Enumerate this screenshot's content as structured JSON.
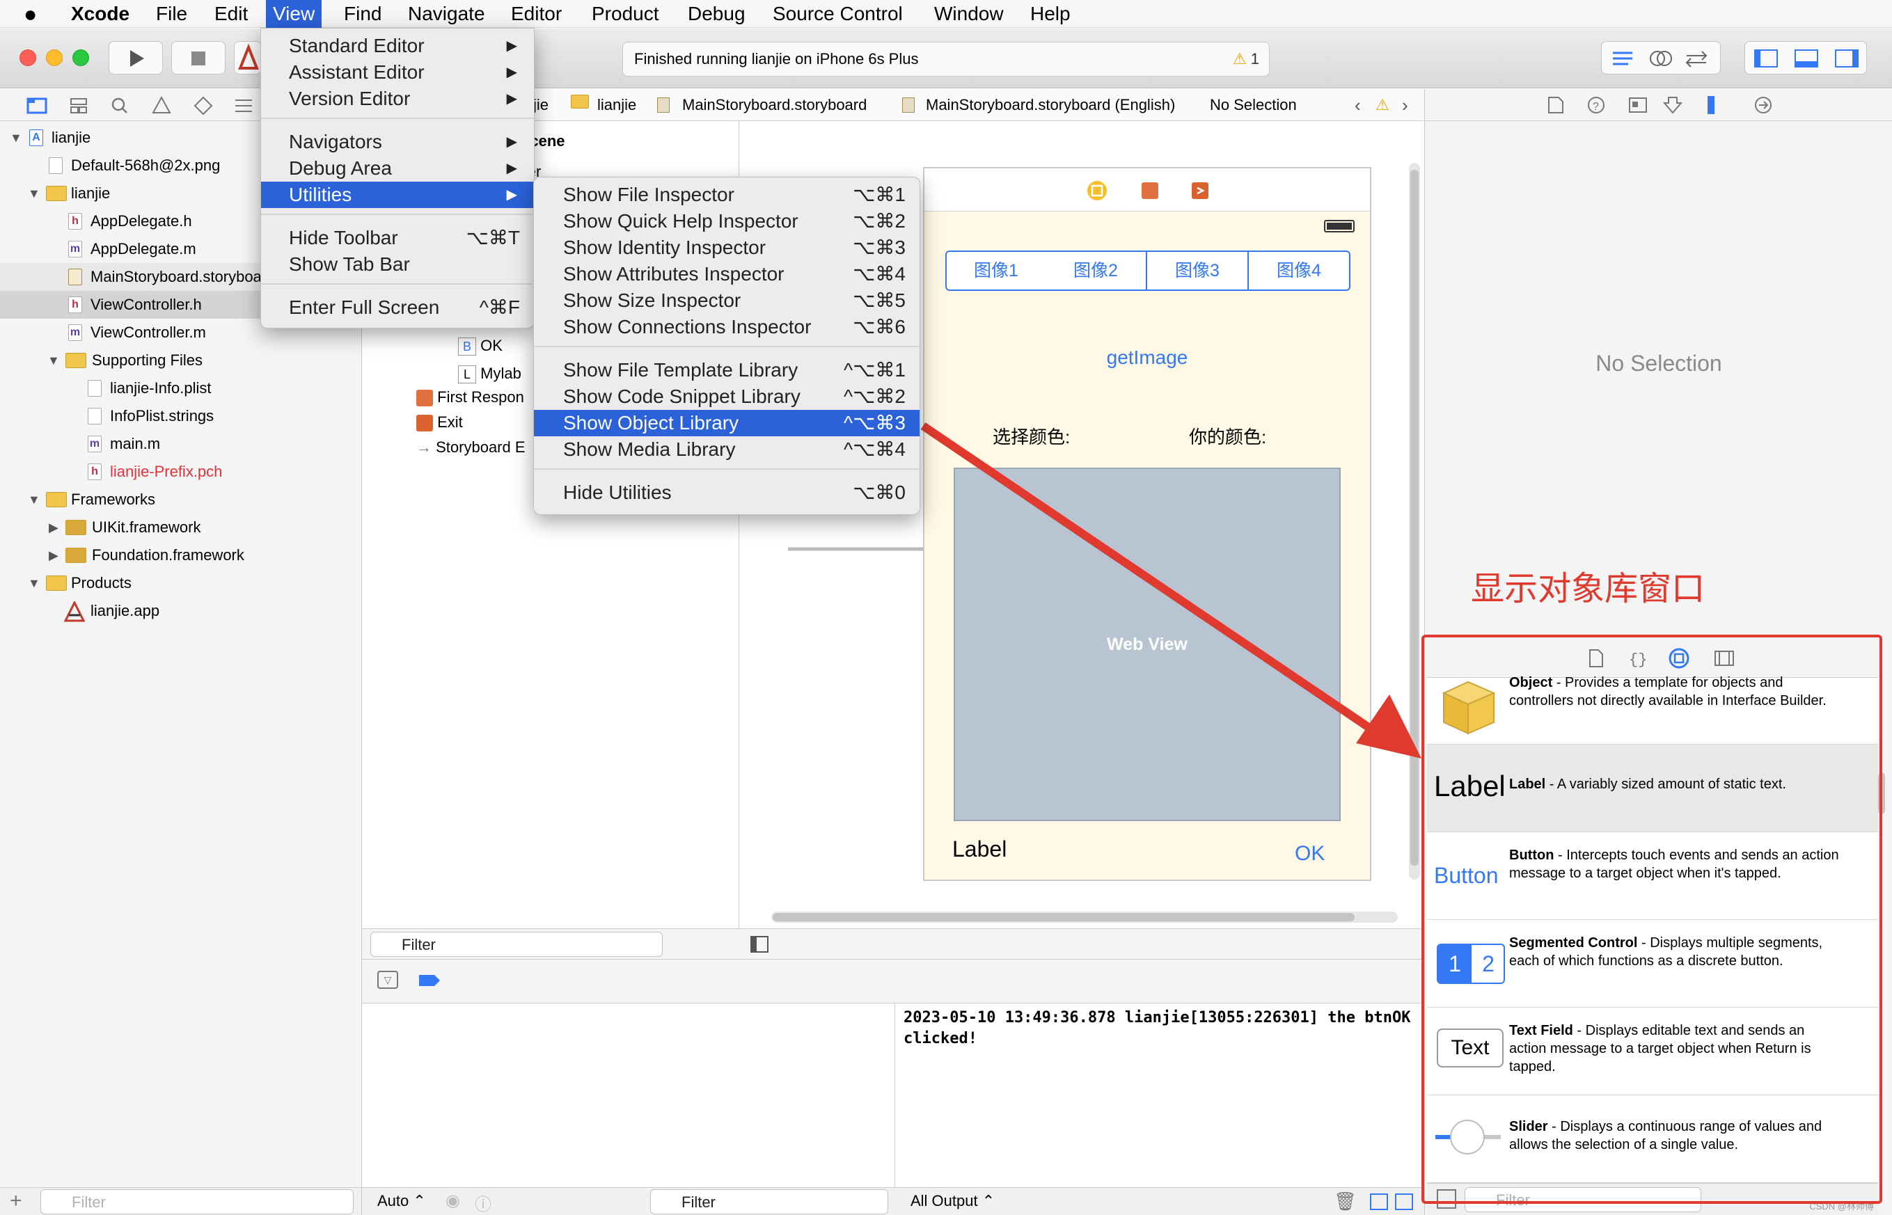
{
  "menubar": {
    "apple_icon": "apple-logo",
    "app_name": "Xcode",
    "items": [
      "File",
      "Edit",
      "View",
      "Find",
      "Navigate",
      "Editor",
      "Product",
      "Debug",
      "Source Control",
      "Window",
      "Help"
    ]
  },
  "toolbar": {
    "status_text": "Finished running lianjie on iPhone 6s Plus",
    "warning_count": "1"
  },
  "jumpbar": {
    "crumbs": [
      "jie",
      "lianjie",
      "MainStoryboard.storyboard",
      "MainStoryboard.storyboard (English)",
      "No Selection"
    ]
  },
  "navigator": {
    "items": [
      {
        "label": "lianjie"
      },
      {
        "label": "Default-568h@2x.png"
      },
      {
        "label": "lianjie"
      },
      {
        "label": "AppDelegate.h"
      },
      {
        "label": "AppDelegate.m"
      },
      {
        "label": "MainStoryboard.storyboard"
      },
      {
        "label": "ViewController.h"
      },
      {
        "label": "ViewController.m"
      },
      {
        "label": "Supporting Files"
      },
      {
        "label": "lianjie-Info.plist"
      },
      {
        "label": "InfoPlist.strings"
      },
      {
        "label": "main.m"
      },
      {
        "label": "lianjie-Prefix.pch"
      },
      {
        "label": "Frameworks"
      },
      {
        "label": "UIKit.framework"
      },
      {
        "label": "Foundation.framework"
      },
      {
        "label": "Products"
      },
      {
        "label": "lianjie.app"
      }
    ],
    "filter_placeholder": "Filter"
  },
  "outline": {
    "scene_title": "r Scene",
    "controller_partial": "ller",
    "ok": "OK",
    "mylab": "Mylab",
    "first_responder": "First Respon",
    "exit": "Exit",
    "storyboard_entry": "Storyboard E",
    "filter_placeholder": "Filter"
  },
  "canvas": {
    "segments": [
      "图像1",
      "图像2",
      "图像3",
      "图像4"
    ],
    "get_image": "getImage",
    "choose_color": "选择颜色:",
    "your_color": "你的颜色:",
    "web_view": "Web View",
    "label": "Label",
    "ok": "OK"
  },
  "debug": {
    "console_text": "2023-05-10 13:49:36.878 lianjie[13055:226301] the btnOK clicked!",
    "auto_label": "Auto",
    "filter_label": "Filter",
    "output_label": "All Output"
  },
  "inspector": {
    "no_selection": "No Selection"
  },
  "annotation": "显示对象库窗口",
  "library": {
    "items": [
      {
        "title": "Object",
        "desc": "Provides a template for objects and controllers not directly available in Interface Builder."
      },
      {
        "title": "Label",
        "desc": "A variably sized amount of static text.",
        "preview": "Label"
      },
      {
        "title": "Button",
        "desc": "Intercepts touch events and sends an action message to a target object when it's tapped.",
        "preview": "Button"
      },
      {
        "title": "Segmented Control",
        "desc": "Displays multiple segments, each of which functions as a discrete button.",
        "preview_1": "1",
        "preview_2": "2"
      },
      {
        "title": "Text Field",
        "desc": "Displays editable text and sends an action message to a target object when Return is tapped.",
        "preview": "Text"
      },
      {
        "title": "Slider",
        "desc": "Displays a continuous range of values and allows the selection of a single value."
      }
    ],
    "filter_placeholder": "Filter",
    "watermark": "CSDN @林师傅"
  },
  "view_menu": {
    "items": [
      {
        "label": "Standard Editor",
        "shortcut": "▶"
      },
      {
        "label": "Assistant Editor",
        "shortcut": "▶"
      },
      {
        "label": "Version Editor",
        "shortcut": "▶"
      },
      {
        "label": "Navigators",
        "shortcut": "▶"
      },
      {
        "label": "Debug Area",
        "shortcut": "▶"
      },
      {
        "label": "Utilities",
        "shortcut": "▶"
      },
      {
        "label": "Hide Toolbar",
        "shortcut": "⌥⌘T"
      },
      {
        "label": "Show Tab Bar",
        "shortcut": ""
      },
      {
        "label": "Enter Full Screen",
        "shortcut": "^⌘F"
      }
    ]
  },
  "utilities_menu": {
    "items": [
      {
        "label": "Show File Inspector",
        "shortcut": "⌥⌘1"
      },
      {
        "label": "Show Quick Help Inspector",
        "shortcut": "⌥⌘2"
      },
      {
        "label": "Show Identity Inspector",
        "shortcut": "⌥⌘3"
      },
      {
        "label": "Show Attributes Inspector",
        "shortcut": "⌥⌘4"
      },
      {
        "label": "Show Size Inspector",
        "shortcut": "⌥⌘5"
      },
      {
        "label": "Show Connections Inspector",
        "shortcut": "⌥⌘6"
      },
      {
        "label": "Show File Template Library",
        "shortcut": "^⌥⌘1"
      },
      {
        "label": "Show Code Snippet Library",
        "shortcut": "^⌥⌘2"
      },
      {
        "label": "Show Object Library",
        "shortcut": "^⌥⌘3"
      },
      {
        "label": "Show Media Library",
        "shortcut": "^⌥⌘4"
      },
      {
        "label": "Hide Utilities",
        "shortcut": "⌥⌘0"
      }
    ]
  },
  "colors": {
    "menu_highlight": "#2b62d9",
    "annotation_red": "#e03a2f",
    "ios_blue": "#3478f6"
  }
}
